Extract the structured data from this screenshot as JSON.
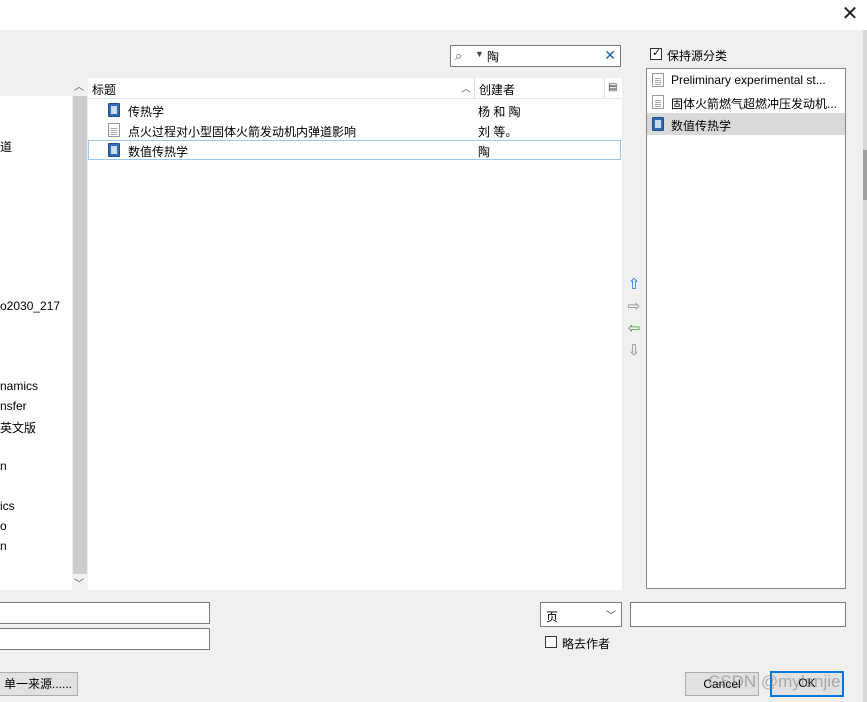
{
  "window": {
    "close_glyph": "✕"
  },
  "search": {
    "value": "陶",
    "icon": "search-icon",
    "clear_glyph": "✕"
  },
  "tree": {
    "items": [
      "道",
      "o2030_217",
      "namics",
      "nsfer",
      "英文版",
      "n",
      "ics",
      "o",
      "n"
    ]
  },
  "list": {
    "col_title": "标题",
    "col_creator": "创建者",
    "rows": [
      {
        "title": "传热学",
        "creator": "杨 和 陶",
        "icon": "book-icon"
      },
      {
        "title": "点火过程对小型固体火箭发动机内弹道影响",
        "creator": "刘 等。",
        "icon": "document-icon"
      },
      {
        "title": "数值传热学",
        "creator": "陶",
        "icon": "book-icon",
        "selected": true
      }
    ]
  },
  "arrows": {
    "up": "⇧",
    "right": "⇨",
    "left": "⇦",
    "down": "⇩"
  },
  "right": {
    "keep_label": "保持源分类",
    "keep_checked": true,
    "items": [
      {
        "title": "Preliminary experimental st...",
        "icon": "document-icon"
      },
      {
        "title": "固体火箭燃气超燃冲压发动机...",
        "icon": "document-icon"
      },
      {
        "title": "数值传热学",
        "icon": "book-icon",
        "selected": true
      }
    ]
  },
  "bottom": {
    "field1": "",
    "field2": "",
    "page_select": "页",
    "page_field": "",
    "omit_author_label": "略去作者",
    "source_button": "单一来源......",
    "cancel": "Cancel",
    "ok": "OK"
  },
  "watermark": "CSDN @mylanjie"
}
